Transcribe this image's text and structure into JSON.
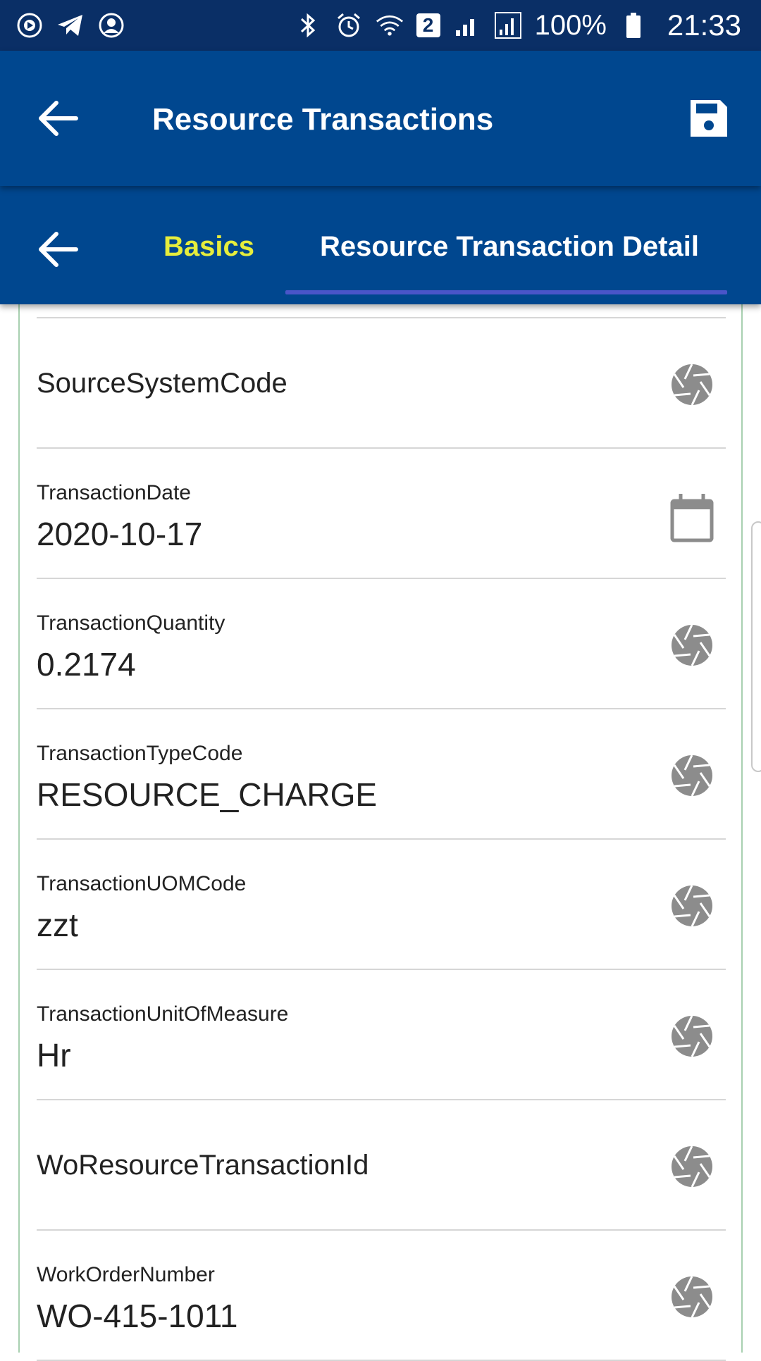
{
  "status_bar": {
    "sim_badge": "2",
    "battery": "100%",
    "time": "21:33"
  },
  "app_bar": {
    "title": "Resource Transactions"
  },
  "tabs": [
    {
      "label": "Basics",
      "color": "#e6ed3c"
    },
    {
      "label": "Resource Transaction Detail",
      "color": "#ffffff"
    }
  ],
  "fields": [
    {
      "label": "SourceSystemCode",
      "value": "",
      "icon": "aperture-icon"
    },
    {
      "label": "TransactionDate",
      "value": "2020-10-17",
      "icon": "calendar-icon"
    },
    {
      "label": "TransactionQuantity",
      "value": "0.2174",
      "icon": "aperture-icon"
    },
    {
      "label": "TransactionTypeCode",
      "value": "RESOURCE_CHARGE",
      "icon": "aperture-icon"
    },
    {
      "label": "TransactionUOMCode",
      "value": "zzt",
      "icon": "aperture-icon"
    },
    {
      "label": "TransactionUnitOfMeasure",
      "value": "Hr",
      "icon": "aperture-icon"
    },
    {
      "label": "WoResourceTransactionId",
      "value": "",
      "icon": "aperture-icon"
    },
    {
      "label": "WorkOrderNumber",
      "value": "WO-415-1011",
      "icon": "aperture-icon"
    }
  ],
  "colors": {
    "status_bar": "#0a2f66",
    "app_bar": "#00478f",
    "tab_indicator": "#4a55c9",
    "active_accent": "#e6ed3c"
  }
}
